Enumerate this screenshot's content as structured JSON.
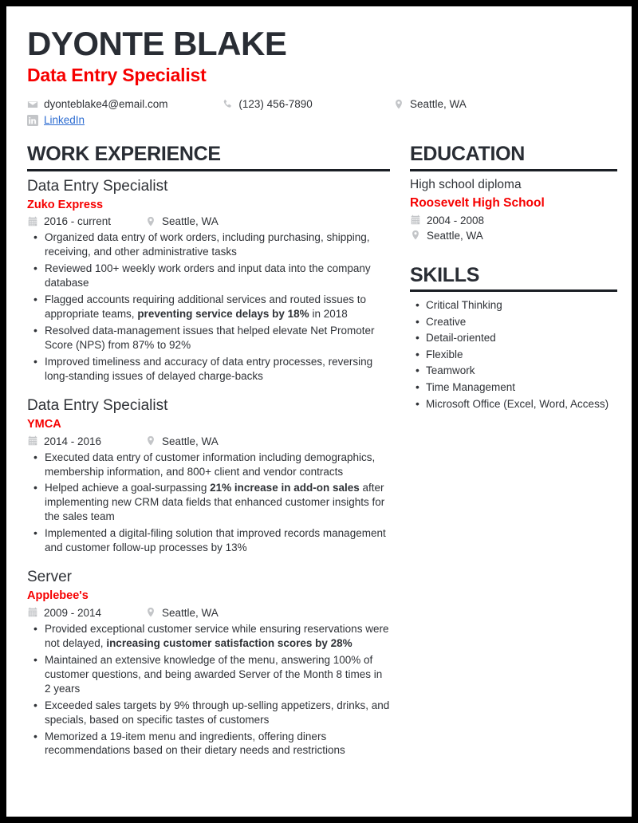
{
  "header": {
    "name": "DYONTE BLAKE",
    "job_title": "Data Entry Specialist",
    "accent_color": "#f60000",
    "text_color": "#292d34",
    "link_color": "#2c6cd1",
    "contacts": {
      "email": "dyonteblake4@email.com",
      "phone": "(123) 456-7890",
      "location": "Seattle, WA",
      "linkedin": "LinkedIn"
    },
    "icons": {
      "email": "envelope-icon",
      "phone": "phone-icon",
      "location": "map-pin-icon",
      "linkedin": "linkedin-icon"
    }
  },
  "sections": {
    "work_experience": {
      "heading": "WORK EXPERIENCE",
      "entries": [
        {
          "role": "Data Entry Specialist",
          "company": "Zuko Express",
          "dates": "2016 - current",
          "location": "Seattle, WA",
          "bullets": [
            {
              "pre": "Organized data entry of work orders, including purchasing, shipping, receiving, and other administrative tasks",
              "bold": "",
              "post": ""
            },
            {
              "pre": "Reviewed 100+ weekly work orders and input data into the company database",
              "bold": "",
              "post": ""
            },
            {
              "pre": "Flagged accounts requiring additional services and routed issues to appropriate teams, ",
              "bold": "preventing service delays by 18%",
              "post": " in 2018"
            },
            {
              "pre": "Resolved data-management issues that helped elevate Net Promoter Score (NPS) from 87% to 92%",
              "bold": "",
              "post": ""
            },
            {
              "pre": "Improved timeliness and accuracy of data entry processes, reversing long-standing issues of delayed charge-backs",
              "bold": "",
              "post": ""
            }
          ]
        },
        {
          "role": "Data Entry Specialist",
          "company": "YMCA",
          "dates": "2014 - 2016",
          "location": "Seattle, WA",
          "bullets": [
            {
              "pre": "Executed data entry of customer information including demographics, membership information, and 800+ client and vendor contracts",
              "bold": "",
              "post": ""
            },
            {
              "pre": "Helped achieve a goal-surpassing ",
              "bold": "21% increase in add-on sales",
              "post": " after implementing new CRM data fields that enhanced customer insights for the sales team"
            },
            {
              "pre": "Implemented a digital-filing solution that improved records management and customer follow-up processes by 13%",
              "bold": "",
              "post": ""
            }
          ]
        },
        {
          "role": "Server",
          "company": "Applebee's",
          "dates": "2009 - 2014",
          "location": "Seattle, WA",
          "bullets": [
            {
              "pre": "Provided exceptional customer service while ensuring reservations were not delayed, ",
              "bold": "increasing customer satisfaction scores by 28%",
              "post": ""
            },
            {
              "pre": "Maintained an extensive knowledge of the menu, answering 100% of customer questions, and being awarded Server of the Month 8 times in 2 years",
              "bold": "",
              "post": ""
            },
            {
              "pre": "Exceeded sales targets by 9% through up-selling appetizers, drinks, and specials, based on specific tastes of customers",
              "bold": "",
              "post": ""
            },
            {
              "pre": "Memorized a 19-item menu and ingredients, offering diners recommendations based on their dietary needs and restrictions",
              "bold": "",
              "post": ""
            }
          ]
        }
      ]
    },
    "education": {
      "heading": "EDUCATION",
      "degree": "High school diploma",
      "school": "Roosevelt High School",
      "dates": "2004 - 2008",
      "location": "Seattle, WA"
    },
    "skills": {
      "heading": "SKILLS",
      "items": [
        "Critical Thinking",
        "Creative",
        "Detail-oriented",
        "Flexible",
        "Teamwork",
        "Time Management",
        "Microsoft Office (Excel, Word, Access)"
      ]
    }
  }
}
